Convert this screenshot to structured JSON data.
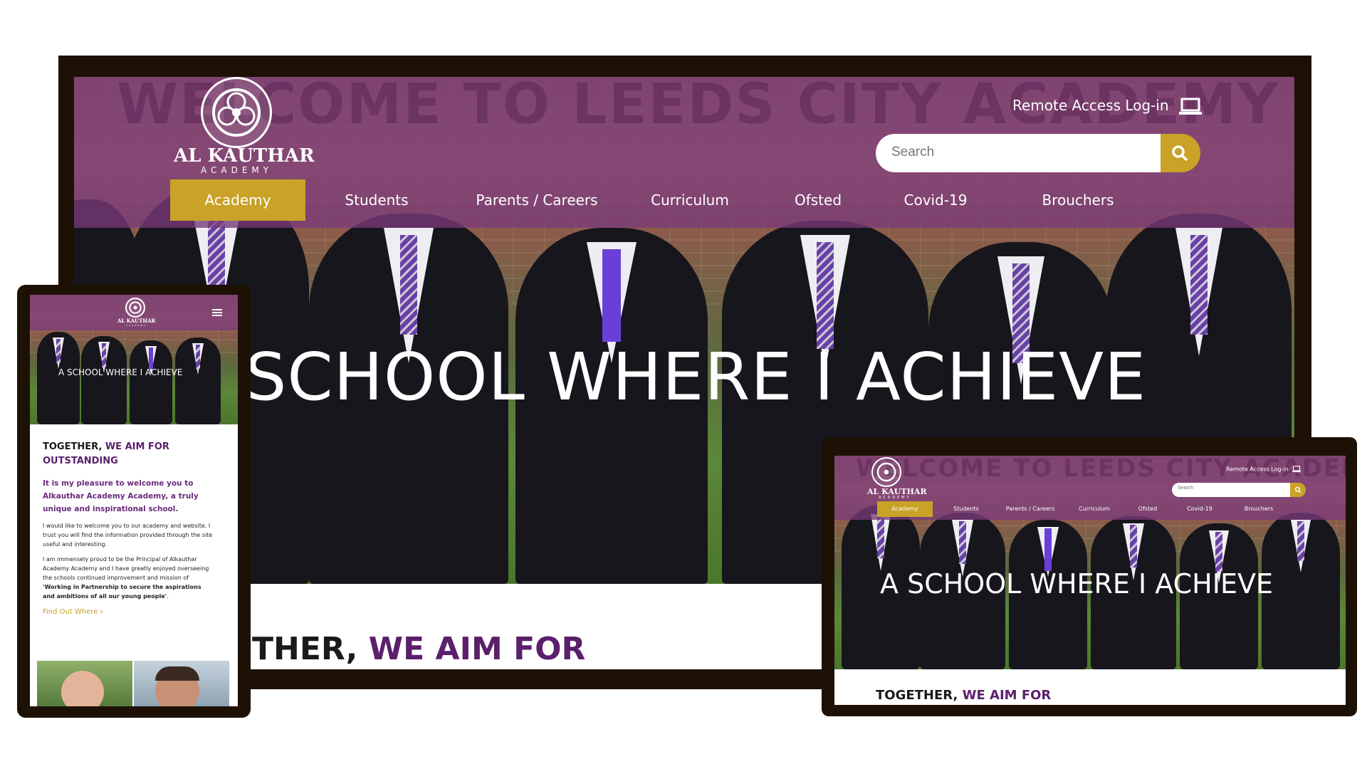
{
  "brand": {
    "name": "AL KAUTHAR",
    "sub": "ACADEMY",
    "watermark": "WELCOME TO LEEDS CITY ACADEMY"
  },
  "header": {
    "remote_access": "Remote Access Log-in",
    "search_placeholder": "Search"
  },
  "nav": {
    "items": [
      {
        "label": "Academy",
        "active": true
      },
      {
        "label": "Students"
      },
      {
        "label": "Parents / Careers"
      },
      {
        "label": "Curriculum"
      },
      {
        "label": "Ofsted"
      },
      {
        "label": "Covid-19"
      },
      {
        "label": "Brouchers"
      }
    ]
  },
  "hero": {
    "desktop_title": "SCHOOL WHERE I ACHIEVE",
    "title": "A SCHOOL WHERE I ACHIEVE"
  },
  "section": {
    "desktop_heading_dark": "THER,",
    "desktop_heading_purple": "WE AIM FOR",
    "heading_dark": "TOGETHER,",
    "heading_purple": "WE AIM FOR",
    "heading_line2": "OUTSTANDING",
    "intro": "It is my pleasure to welcome you to Alkauthar Academy Academy, a truly unique and inspirational school.",
    "para1": "I would like to welcome you to our academy and website. I trust you will find the information provided through the site useful and interesting.",
    "para2_start": "I am immensely proud to be the Principal of Alkauthar Academy Academy and I have greatly enjoyed overseeing the schools continued improvement and mission of ",
    "para2_bold": "'Working in Partnership to secure the aspirations and ambitions of all our young people'",
    "para2_end": ".",
    "link": "Find Out Where",
    "link_chevron": "›"
  },
  "colors": {
    "purple": "#783a78",
    "gold": "#c9a227",
    "frame": "#1d1106",
    "heading_purple": "#5b1f6b"
  },
  "icons": {
    "search": "search-icon",
    "laptop": "laptop-icon",
    "menu": "hamburger-menu-icon",
    "logo": "academy-crest-icon"
  }
}
